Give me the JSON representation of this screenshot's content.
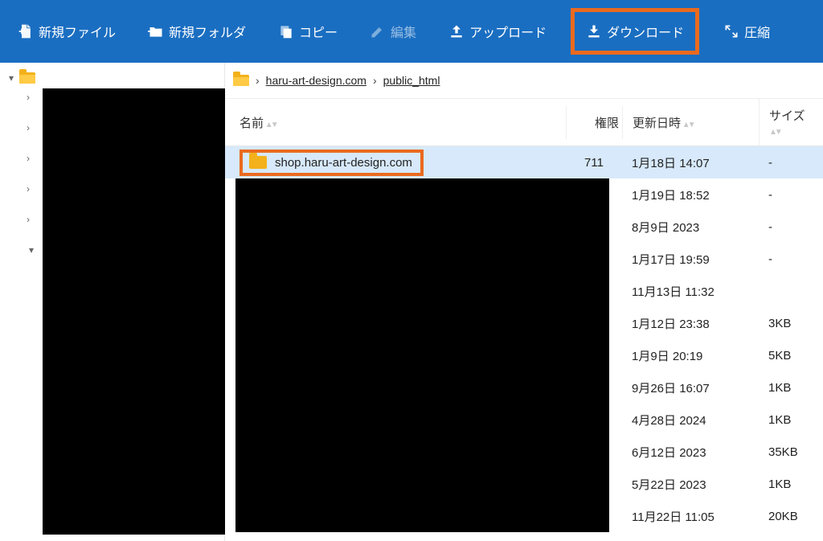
{
  "toolbar": {
    "new_file": "新規ファイル",
    "new_folder": "新規フォルダ",
    "copy": "コピー",
    "edit": "編集",
    "upload": "アップロード",
    "download": "ダウンロード",
    "compress": "圧縮"
  },
  "breadcrumb": {
    "segments": [
      "haru-art-design.com",
      "public_html"
    ]
  },
  "columns": {
    "name": "名前",
    "perm": "権限",
    "date": "更新日時",
    "size": "サイズ"
  },
  "rows": [
    {
      "name": "shop.haru-art-design.com",
      "perm": "711",
      "date": "1月18日 14:07",
      "size": "-",
      "selected": true
    },
    {
      "name": "",
      "perm": "",
      "date": "1月19日 18:52",
      "size": "-",
      "selected": false
    },
    {
      "name": "",
      "perm": "",
      "date": "8月9日 2023",
      "size": "-",
      "selected": false
    },
    {
      "name": "",
      "perm": "",
      "date": "1月17日 19:59",
      "size": "-",
      "selected": false
    },
    {
      "name": "",
      "perm": "",
      "date": "11月13日 11:32",
      "size": "",
      "selected": false
    },
    {
      "name": "",
      "perm": "",
      "date": "1月12日 23:38",
      "size": "3KB",
      "selected": false
    },
    {
      "name": "",
      "perm": "",
      "date": "1月9日 20:19",
      "size": "5KB",
      "selected": false
    },
    {
      "name": "",
      "perm": "",
      "date": "9月26日 16:07",
      "size": "1KB",
      "selected": false
    },
    {
      "name": "",
      "perm": "",
      "date": "4月28日 2024",
      "size": "1KB",
      "selected": false
    },
    {
      "name": "",
      "perm": "",
      "date": "6月12日 2023",
      "size": "35KB",
      "selected": false
    },
    {
      "name": "",
      "perm": "",
      "date": "5月22日 2023",
      "size": "1KB",
      "selected": false
    },
    {
      "name": "",
      "perm": "",
      "date": "11月22日 11:05",
      "size": "20KB",
      "selected": false
    }
  ]
}
